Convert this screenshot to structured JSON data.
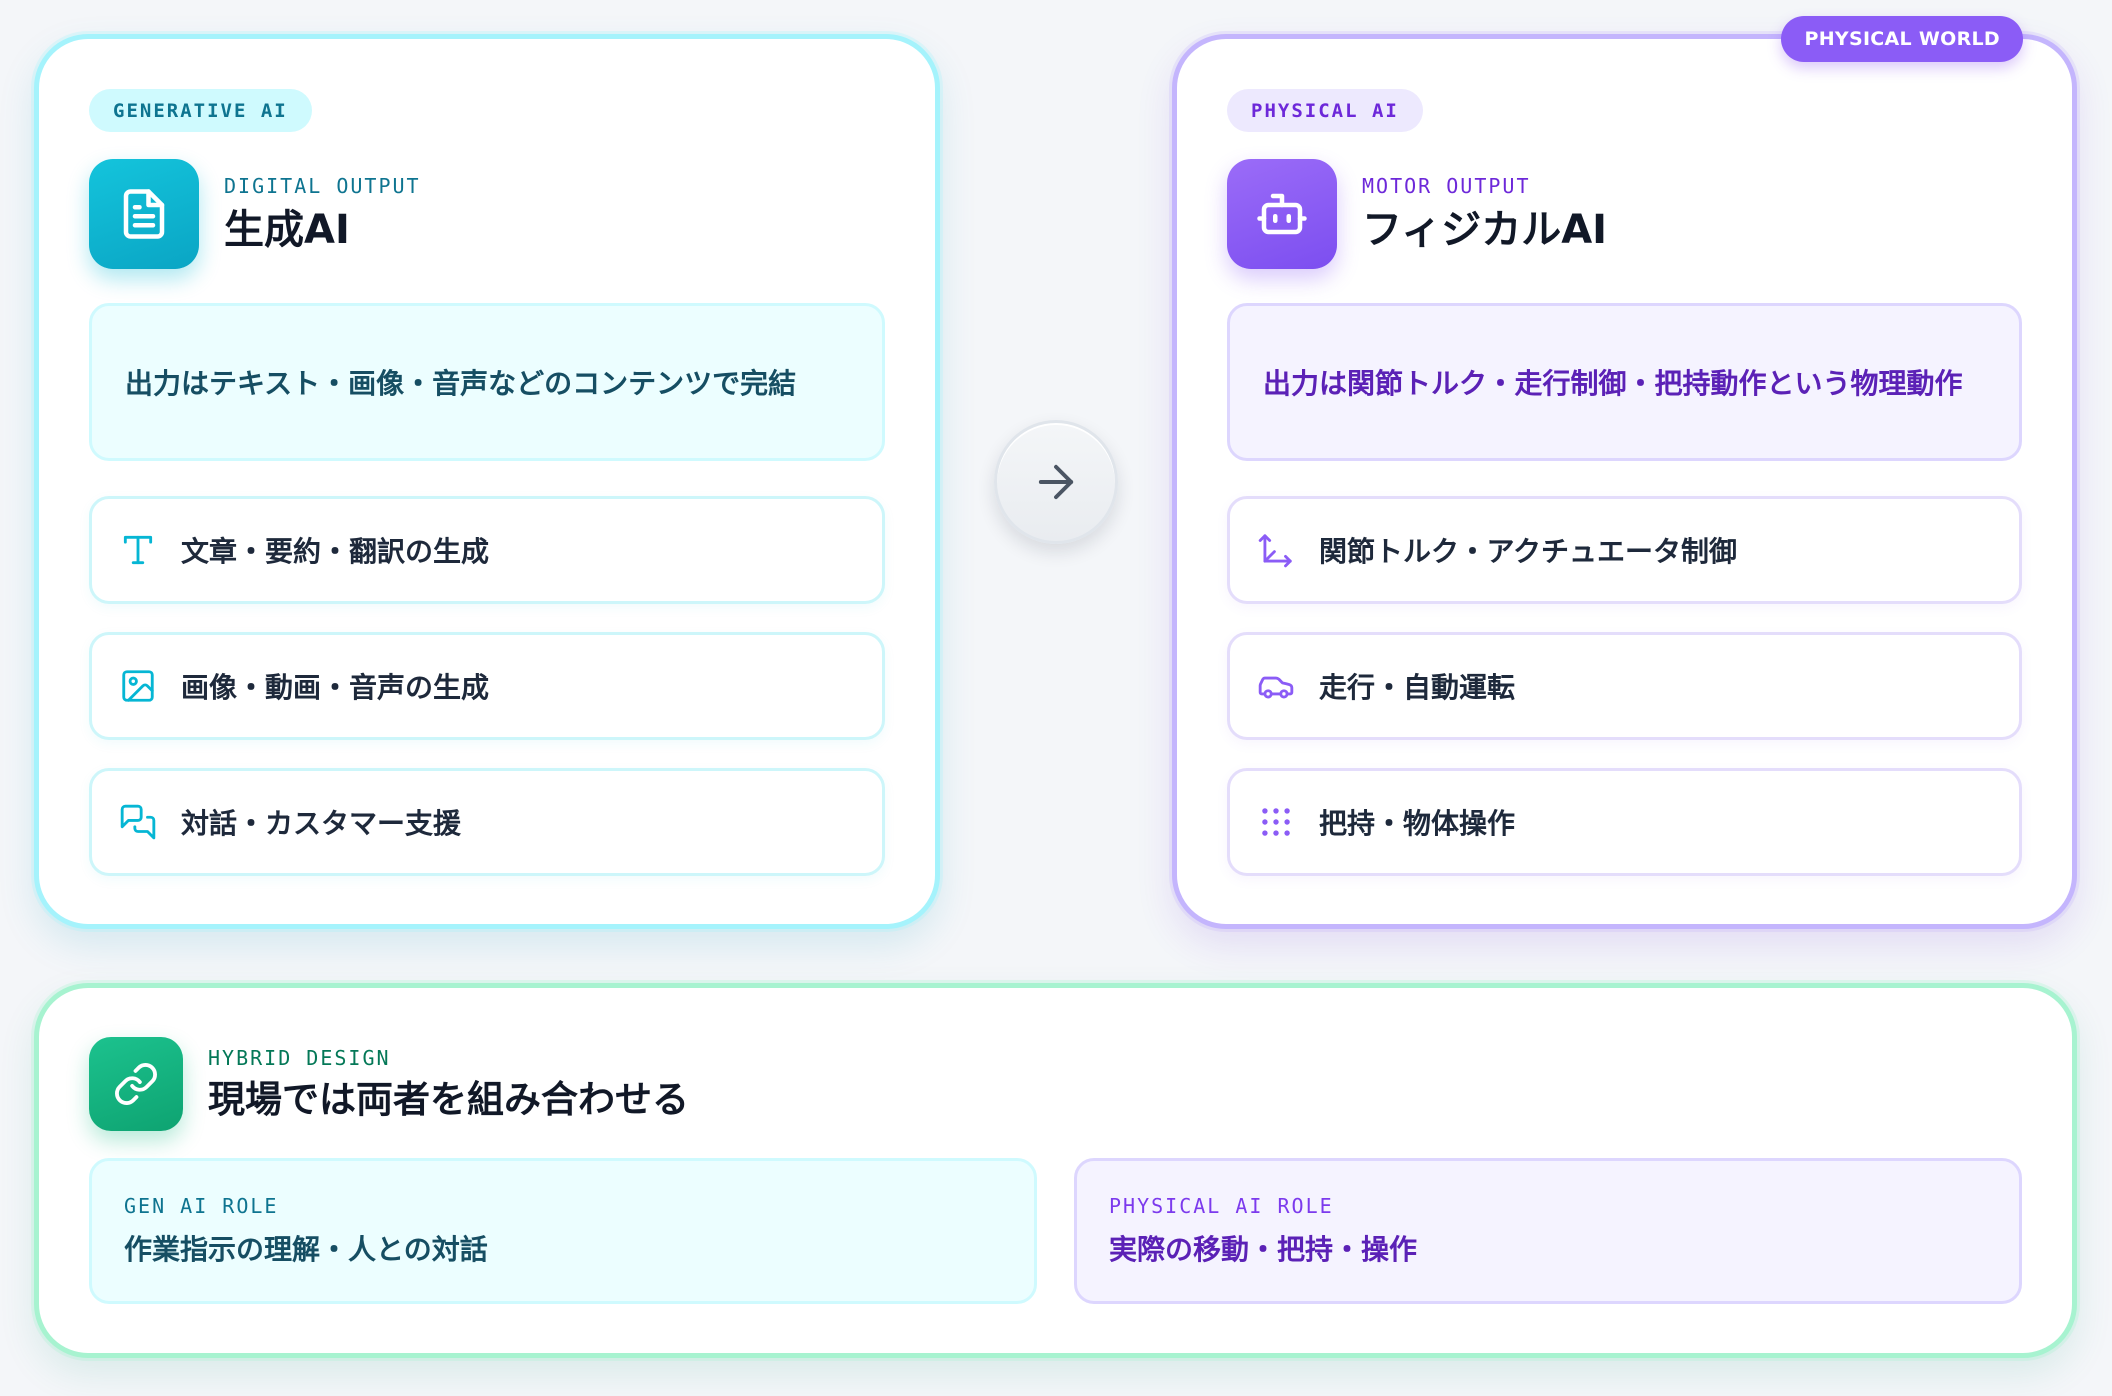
{
  "generative": {
    "tag": "GENERATIVE AI",
    "eyebrow": "DIGITAL OUTPUT",
    "title": "生成AI",
    "icon": "document-icon",
    "summary": "出力はテキスト・画像・音声などのコンテンツで完結",
    "items": [
      {
        "icon": "text-type-icon",
        "label": "文章・要約・翻訳の生成"
      },
      {
        "icon": "image-icon",
        "label": "画像・動画・音声の生成"
      },
      {
        "icon": "chat-bubbles-icon",
        "label": "対話・カスタマー支援"
      }
    ]
  },
  "transition": {
    "icon": "arrow-right-icon"
  },
  "physical": {
    "badge": "PHYSICAL WORLD",
    "tag": "PHYSICAL AI",
    "eyebrow": "MOTOR OUTPUT",
    "title": "フィジカルAI",
    "icon": "robot-icon",
    "summary": "出力は関節トルク・走行制御・把持動作という物理動作",
    "items": [
      {
        "icon": "axis-joint-icon",
        "label": "関節トルク・アクチュエータ制御"
      },
      {
        "icon": "car-icon",
        "label": "走行・自動運転"
      },
      {
        "icon": "grip-dots-icon",
        "label": "把持・物体操作"
      }
    ]
  },
  "hybrid": {
    "eyebrow": "HYBRID DESIGN",
    "title": "現場では両者を組み合わせる",
    "icon": "link-icon",
    "roles": [
      {
        "label": "GEN AI ROLE",
        "text": "作業指示の理解・人との対話"
      },
      {
        "label": "PHYSICAL AI ROLE",
        "text": "実際の移動・把持・操作"
      }
    ]
  },
  "colors": {
    "generative_accent": "#06b6d4",
    "physical_accent": "#8b5cf6",
    "hybrid_accent": "#10b981",
    "background": "#f4f6f9"
  }
}
